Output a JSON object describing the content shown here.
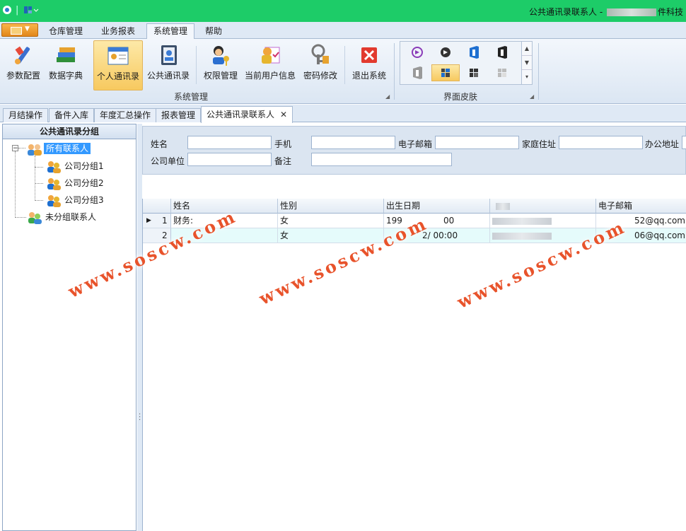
{
  "window": {
    "title": "公共通讯录联系人 - ",
    "title_suffix": "件科技"
  },
  "ribbon_tabs": [
    "仓库管理",
    "业务报表",
    "系统管理",
    "帮助"
  ],
  "ribbon": {
    "system_group": {
      "label": "系统管理",
      "buttons": [
        "参数配置",
        "数据字典",
        "个人通讯录",
        "公共通讯录",
        "权限管理",
        "当前用户信息",
        "密码修改",
        "退出系统"
      ]
    },
    "skin_group": {
      "label": "界面皮肤"
    }
  },
  "doc_tabs": [
    "月结操作",
    "备件入库",
    "年度汇总操作",
    "报表管理",
    "公共通讯录联系人"
  ],
  "doc_tab_close": "✕",
  "tree": {
    "title": "公共通讯录分组",
    "root": "所有联系人",
    "groups": [
      "公司分组1",
      "公司分组2",
      "公司分组3"
    ],
    "ungrouped": "未分组联系人"
  },
  "search": {
    "name": "姓名",
    "mobile": "手机",
    "email": "电子邮箱",
    "home_address": "家庭住址",
    "office_address": "办公地址",
    "company": "公司单位",
    "remark": "备注"
  },
  "grid": {
    "columns": [
      "姓名",
      "性别",
      "出生日期",
      "",
      "电子邮箱"
    ],
    "rows": [
      {
        "num": "1",
        "name": "财务:",
        "gender": "女",
        "birth": "199",
        "birth_tail": "00",
        "email": "52@qq.com",
        "current": true
      },
      {
        "num": "2",
        "name": "",
        "gender": "女",
        "birth": "",
        "birth_tail": "2/ 00:00",
        "email": "06@qq.com",
        "current": false
      }
    ]
  },
  "watermark": "www.soscw.com",
  "colors": {
    "titlebar": "#1dcc68",
    "accent": "#3399ff",
    "selected": "#f7c95f",
    "watermark": "#e8532b"
  }
}
